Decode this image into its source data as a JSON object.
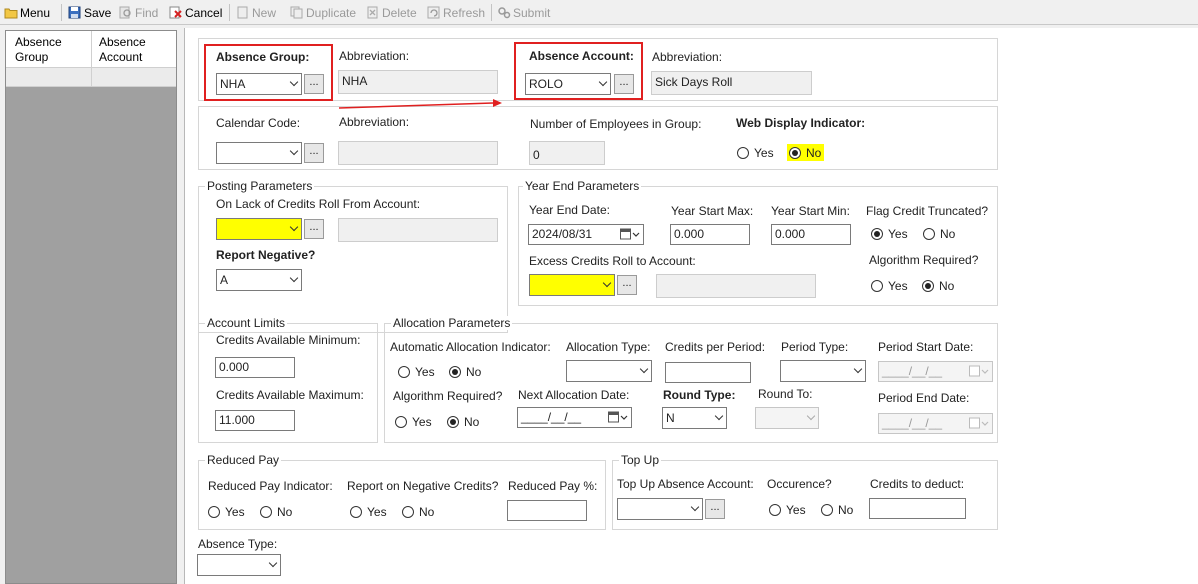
{
  "toolbar": {
    "menu": "Menu",
    "save": "Save",
    "find": "Find",
    "cancel": "Cancel",
    "new": "New",
    "duplicate": "Duplicate",
    "delete": "Delete",
    "refresh": "Refresh",
    "submit": "Submit"
  },
  "left_list": {
    "col1": [
      "Absence",
      "Group"
    ],
    "col2": [
      "Absence",
      "Account"
    ]
  },
  "header": {
    "absence_group_label": "Absence Group:",
    "absence_group_value": "NHA",
    "abbrev_label": "Abbreviation:",
    "group_abbrev_value": "NHA",
    "absence_account_label": "Absence Account:",
    "absence_account_value": "ROLO",
    "account_abbrev_value": "Sick Days Roll",
    "calendar_code_label": "Calendar Code:",
    "calendar_code_value": "",
    "calendar_abbrev_value": "",
    "num_employees_label": "Number of Employees in Group:",
    "num_employees_value": "0",
    "web_display_label": "Web Display Indicator:",
    "yes": "Yes",
    "no": "No",
    "web_display_selected": "No"
  },
  "posting": {
    "title": "Posting Parameters",
    "lack_credits_label": "On Lack of Credits Roll From Account:",
    "lack_credits_value": "",
    "report_negative_label": "Report Negative?",
    "report_negative_value": "A"
  },
  "year_end": {
    "title": "Year End Parameters",
    "year_end_date_label": "Year End Date:",
    "year_end_date_value": "2024/08/31",
    "year_start_max_label": "Year Start Max:",
    "year_start_max_value": "0.000",
    "year_start_min_label": "Year Start Min:",
    "year_start_min_value": "0.000",
    "flag_credit_label": "Flag Credit Truncated?",
    "flag_credit_selected": "Yes",
    "excess_credits_label": "Excess Credits Roll to Account:",
    "excess_credits_value": "",
    "algorithm_required_label": "Algorithm Required?",
    "algorithm_required_selected": "No"
  },
  "account_limits": {
    "title": "Account Limits",
    "min_label": "Credits Available Minimum:",
    "min_value": "0.000",
    "max_label": "Credits Available Maximum:",
    "max_value": "11.000"
  },
  "allocation": {
    "title": "Allocation Parameters",
    "auto_alloc_label": "Automatic Allocation Indicator:",
    "auto_alloc_selected": "No",
    "alloc_type_label": "Allocation Type:",
    "credits_per_period_label": "Credits per Period:",
    "period_type_label": "Period Type:",
    "period_start_label": "Period Start Date:",
    "period_start_value": "____/__/__",
    "algorithm_required_label": "Algorithm Required?",
    "algorithm_selected": "No",
    "next_alloc_label": "Next Allocation Date:",
    "next_alloc_value": "____/__/__",
    "round_type_label": "Round Type:",
    "round_type_value": "N",
    "round_to_label": "Round To:",
    "period_end_label": "Period End Date:",
    "period_end_value": "____/__/__"
  },
  "reduced_pay": {
    "title": "Reduced Pay",
    "indicator_label": "Reduced Pay Indicator:",
    "report_neg_label": "Report on Negative Credits?",
    "pct_label": "Reduced Pay %:"
  },
  "top_up": {
    "title": "Top Up",
    "account_label": "Top Up Absence Account:",
    "occurence_label": "Occurence?",
    "credits_deduct_label": "Credits to deduct:"
  },
  "absence_type_label": "Absence Type:",
  "dots_label": "...",
  "colors": {
    "highlight": "#ffff00",
    "annotation_red": "#e02020",
    "left_panel": "#a0a0a0"
  }
}
